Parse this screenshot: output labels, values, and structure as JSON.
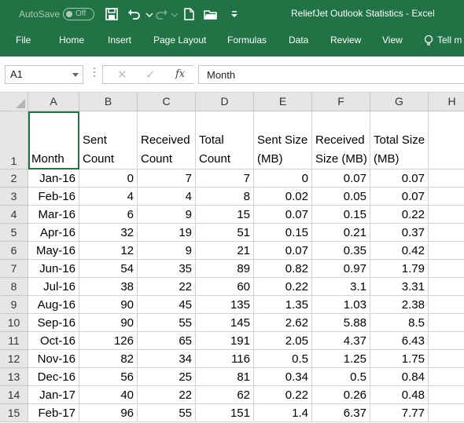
{
  "title_bar": {
    "autosave_label": "AutoSave",
    "autosave_state": "Off",
    "window_title": "ReliefJet Outlook Statistics  -  Excel",
    "accent_color": "#217346"
  },
  "ribbon": {
    "tabs": [
      "File",
      "Home",
      "Insert",
      "Page Layout",
      "Formulas",
      "Data",
      "Review",
      "View",
      "Tell m"
    ]
  },
  "formula_bar": {
    "name_box": "A1",
    "fx_label": "fx",
    "formula_value": "Month"
  },
  "sheet": {
    "columns": [
      "A",
      "B",
      "C",
      "D",
      "E",
      "F",
      "G",
      "H"
    ],
    "header_row": {
      "row_number": "1",
      "cells": [
        [
          "Month"
        ],
        [
          "Sent",
          "Count"
        ],
        [
          "Received",
          "Count"
        ],
        [
          "Total",
          "Count"
        ],
        [
          "Sent Size",
          "(MB)"
        ],
        [
          "Received",
          "Size (MB)"
        ],
        [
          "Total Size",
          "(MB)"
        ]
      ]
    },
    "rows": [
      {
        "n": "2",
        "cells": [
          "Jan-16",
          "0",
          "7",
          "7",
          "0",
          "0.07",
          "0.07"
        ]
      },
      {
        "n": "3",
        "cells": [
          "Feb-16",
          "4",
          "4",
          "8",
          "0.02",
          "0.05",
          "0.07"
        ]
      },
      {
        "n": "4",
        "cells": [
          "Mar-16",
          "6",
          "9",
          "15",
          "0.07",
          "0.15",
          "0.22"
        ]
      },
      {
        "n": "5",
        "cells": [
          "Apr-16",
          "32",
          "19",
          "51",
          "0.15",
          "0.21",
          "0.37"
        ]
      },
      {
        "n": "6",
        "cells": [
          "May-16",
          "12",
          "9",
          "21",
          "0.07",
          "0.35",
          "0.42"
        ]
      },
      {
        "n": "7",
        "cells": [
          "Jun-16",
          "54",
          "35",
          "89",
          "0.82",
          "0.97",
          "1.79"
        ]
      },
      {
        "n": "8",
        "cells": [
          "Jul-16",
          "38",
          "22",
          "60",
          "0.22",
          "3.1",
          "3.31"
        ]
      },
      {
        "n": "9",
        "cells": [
          "Aug-16",
          "90",
          "45",
          "135",
          "1.35",
          "1.03",
          "2.38"
        ]
      },
      {
        "n": "10",
        "cells": [
          "Sep-16",
          "90",
          "55",
          "145",
          "2.62",
          "5.88",
          "8.5"
        ]
      },
      {
        "n": "11",
        "cells": [
          "Oct-16",
          "126",
          "65",
          "191",
          "2.05",
          "4.37",
          "6.43"
        ]
      },
      {
        "n": "12",
        "cells": [
          "Nov-16",
          "82",
          "34",
          "116",
          "0.5",
          "1.25",
          "1.75"
        ]
      },
      {
        "n": "13",
        "cells": [
          "Dec-16",
          "56",
          "25",
          "81",
          "0.34",
          "0.5",
          "0.84"
        ]
      },
      {
        "n": "14",
        "cells": [
          "Jan-17",
          "40",
          "22",
          "62",
          "0.22",
          "0.26",
          "0.48"
        ]
      },
      {
        "n": "15",
        "cells": [
          "Feb-17",
          "96",
          "55",
          "151",
          "1.4",
          "6.37",
          "7.77"
        ]
      }
    ]
  }
}
